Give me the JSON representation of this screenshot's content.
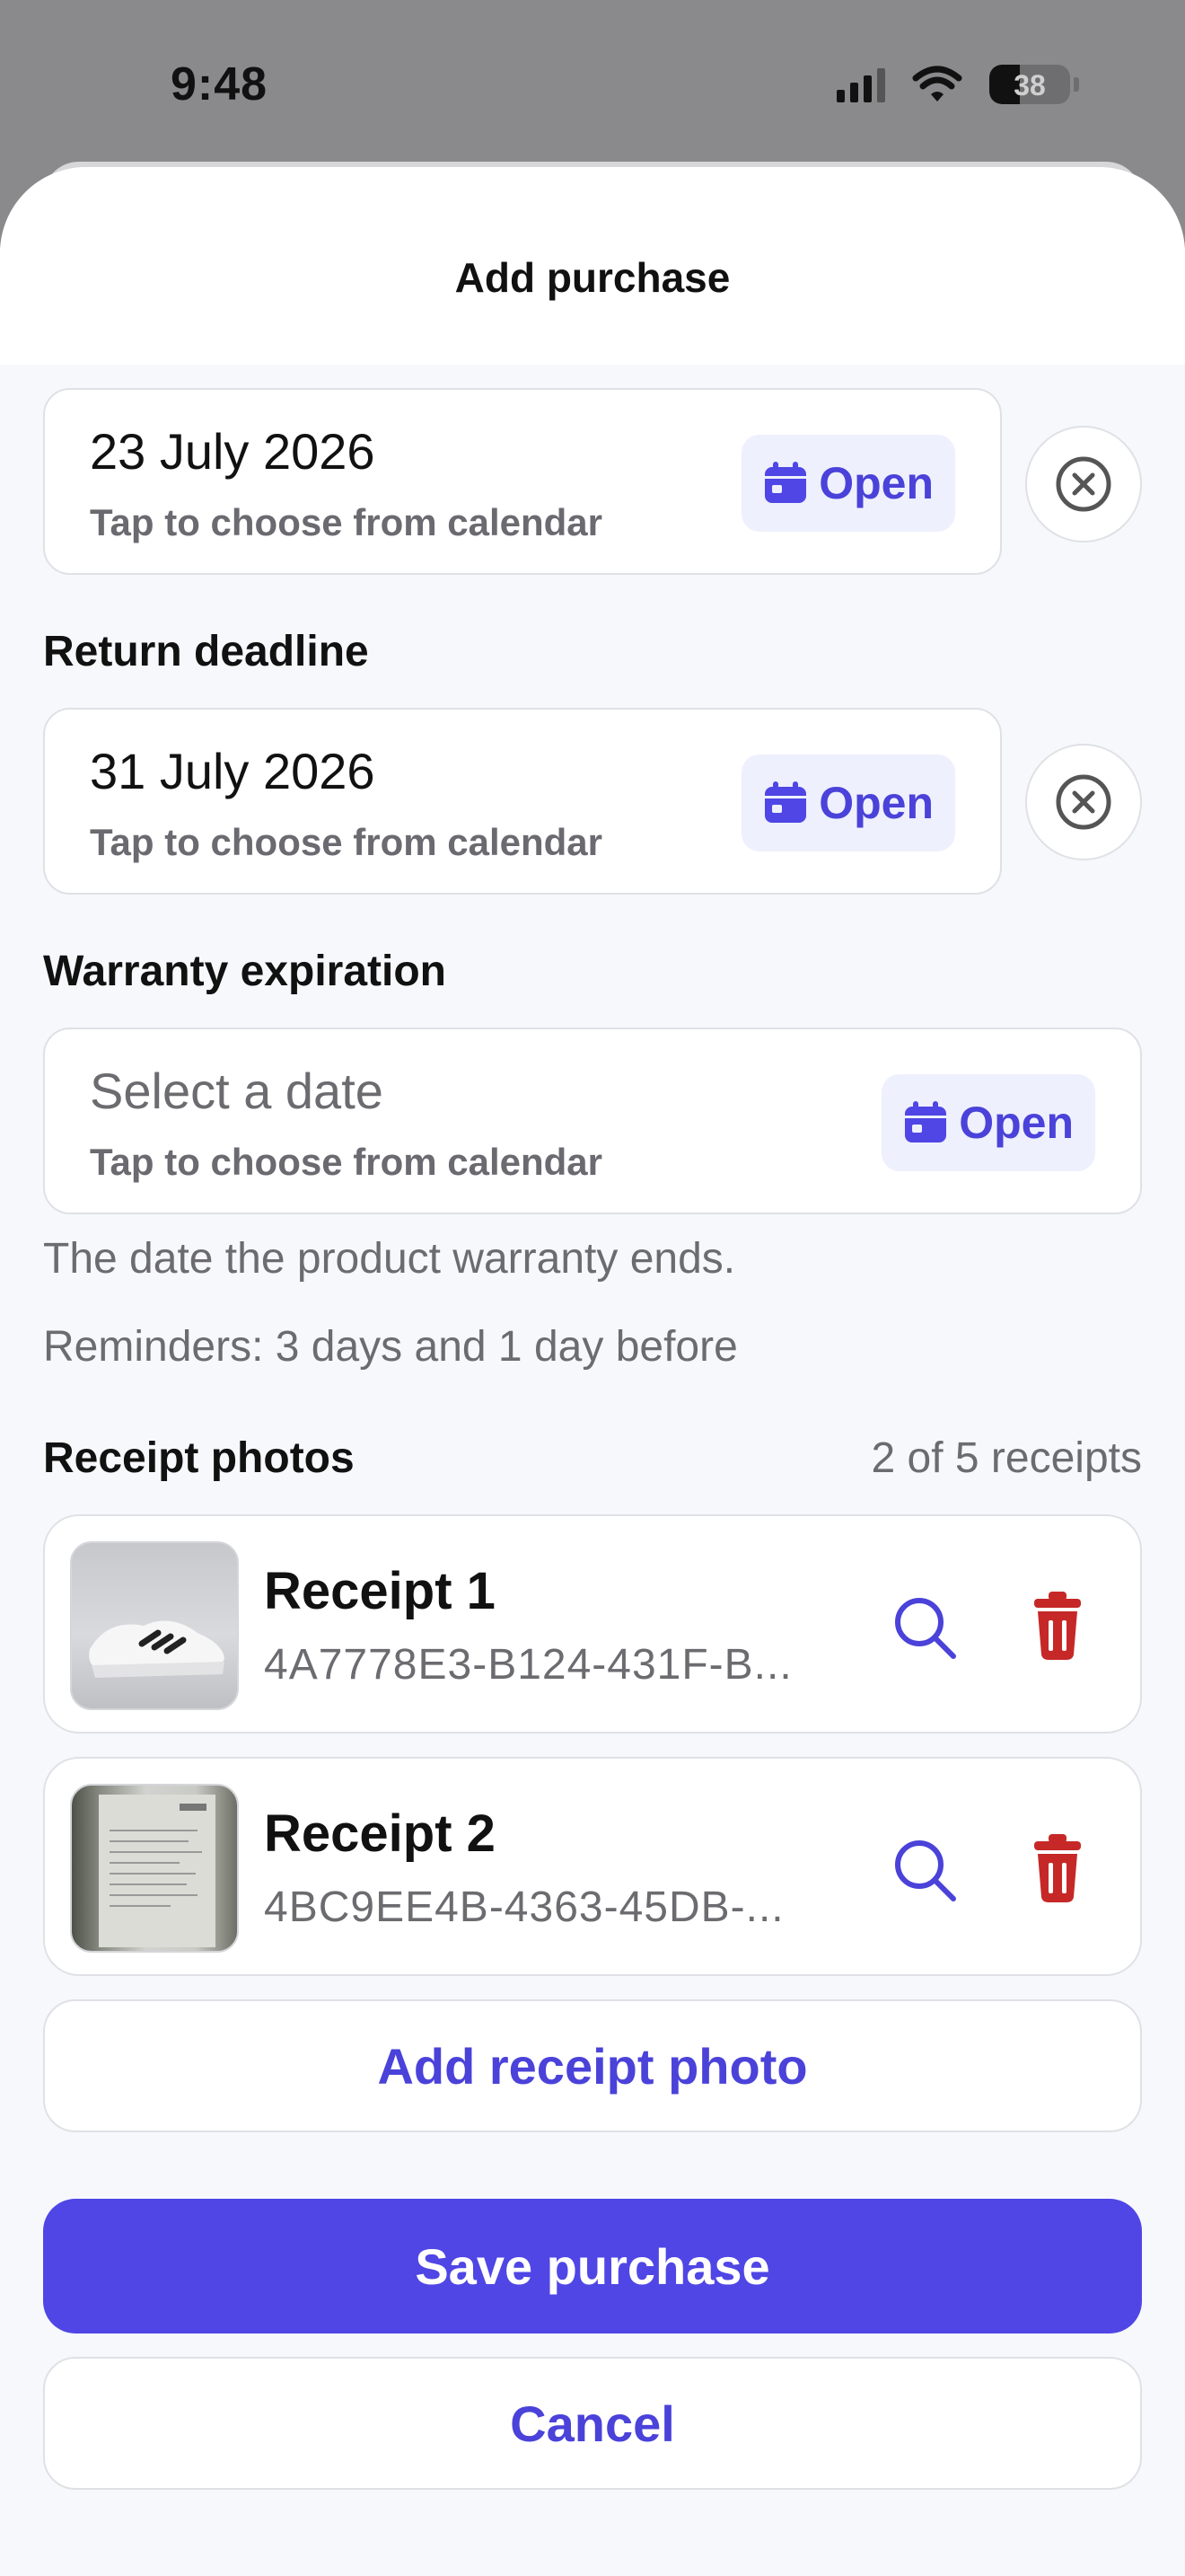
{
  "status_bar": {
    "time": "9:48",
    "battery": "38"
  },
  "sheet": {
    "title": "Add purchase"
  },
  "purchase_date": {
    "value": "23 July 2026",
    "hint": "Tap to choose from calendar",
    "open_label": "Open"
  },
  "return_deadline": {
    "label": "Return deadline",
    "value": "31 July 2026",
    "hint": "Tap to choose from calendar",
    "open_label": "Open"
  },
  "warranty": {
    "label": "Warranty expiration",
    "placeholder": "Select a date",
    "hint": "Tap to choose from calendar",
    "open_label": "Open",
    "description": "The date the product warranty ends.",
    "reminders": "Reminders: 3 days and 1 day before"
  },
  "receipts": {
    "label": "Receipt photos",
    "count": "2 of 5 receipts",
    "items": [
      {
        "name": "Receipt 1",
        "id": "4A7778E3-B124-431F-B..."
      },
      {
        "name": "Receipt 2",
        "id": "4BC9EE4B-4363-45DB-..."
      }
    ],
    "add_label": "Add receipt photo"
  },
  "actions": {
    "save_label": "Save purchase",
    "cancel_label": "Cancel"
  },
  "colors": {
    "accent": "#4f46e5",
    "accent_text": "#4a42d9",
    "delete": "#c62828",
    "open_bg": "#eef0fd"
  }
}
